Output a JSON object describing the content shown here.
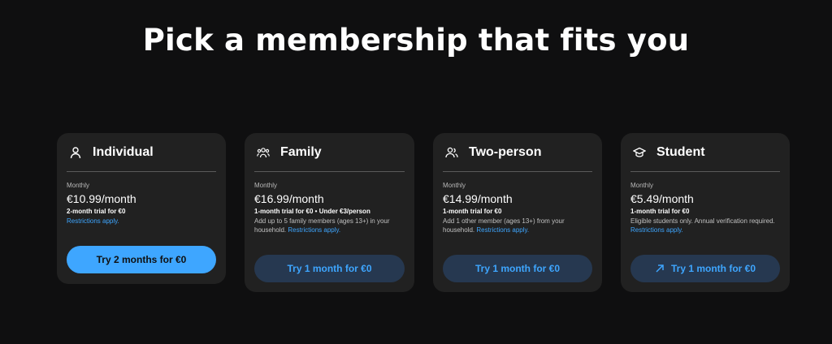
{
  "heading": "Pick a membership that fits you",
  "colors": {
    "accent": "#3ea6ff",
    "card_bg": "#212121",
    "page_bg": "#0f0f10",
    "secondary_btn_bg": "#263850"
  },
  "plans": [
    {
      "name": "Individual",
      "icon": "person-icon",
      "period": "Monthly",
      "price": "€10.99/month",
      "trial": "2-month trial for €0",
      "description": "",
      "restrictions": "Restrictions apply.",
      "button": "Try 2 months for €0"
    },
    {
      "name": "Family",
      "icon": "family-icon",
      "period": "Monthly",
      "price": "€16.99/month",
      "trial": "1-month trial for €0 • Under €3/person",
      "description": "Add up to 5 family members (ages 13+) in your household.",
      "restrictions": "Restrictions apply.",
      "button": "Try 1 month for €0"
    },
    {
      "name": "Two-person",
      "icon": "two-person-icon",
      "period": "Monthly",
      "price": "€14.99/month",
      "trial": "1-month trial for €0",
      "description": "Add 1 other member (ages 13+) from your household.",
      "restrictions": "Restrictions apply.",
      "button": "Try 1 month for €0"
    },
    {
      "name": "Student",
      "icon": "graduation-cap-icon",
      "period": "Monthly",
      "price": "€5.49/month",
      "trial": "1-month trial for €0",
      "description": "Eligible students only. Annual verification required.",
      "restrictions": "Restrictions apply.",
      "button": "Try 1 month for €0",
      "button_icon": "external-arrow-icon"
    }
  ]
}
